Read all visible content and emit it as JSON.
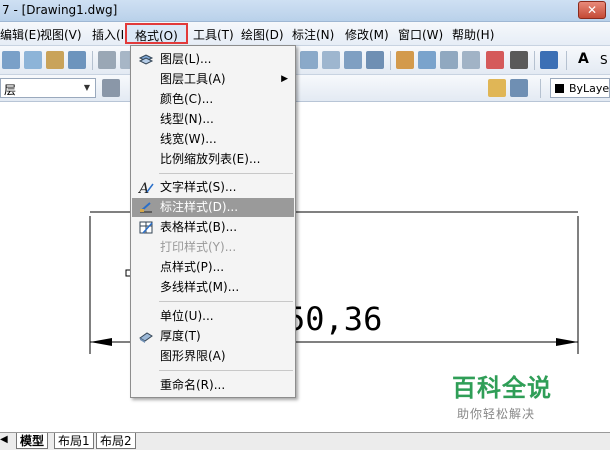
{
  "window": {
    "title": "7 - [Drawing1.dwg]",
    "close_glyph": "✕"
  },
  "menubar": {
    "items": [
      {
        "label": "编辑(E)"
      },
      {
        "label": "视图(V)"
      },
      {
        "label": "插入(I)"
      },
      {
        "label": "格式(O)"
      },
      {
        "label": "工具(T)"
      },
      {
        "label": "绘图(D)"
      },
      {
        "label": "标注(N)"
      },
      {
        "label": "修改(M)"
      },
      {
        "label": "窗口(W)"
      },
      {
        "label": "帮助(H)"
      }
    ]
  },
  "toolbar": {
    "layer_combo_value": "层",
    "style_label": "S",
    "bylayer_label": "ByLayer"
  },
  "format_menu": {
    "items": [
      {
        "label": "图层(L)...",
        "icon": "layers-icon"
      },
      {
        "label": "图层工具(A)",
        "submenu": true
      },
      {
        "label": "颜色(C)..."
      },
      {
        "label": "线型(N)..."
      },
      {
        "label": "线宽(W)..."
      },
      {
        "label": "比例缩放列表(E)..."
      },
      {
        "label": "文字样式(S)...",
        "icon": "text-style-icon"
      },
      {
        "label": "标注样式(D)...",
        "icon": "dimension-style-icon",
        "highlighted": true
      },
      {
        "label": "表格样式(B)...",
        "icon": "table-style-icon"
      },
      {
        "label": "打印样式(Y)...",
        "disabled": true
      },
      {
        "label": "点样式(P)..."
      },
      {
        "label": "多线样式(M)..."
      },
      {
        "label": "单位(U)..."
      },
      {
        "label": "厚度(T)",
        "icon": "thickness-icon"
      },
      {
        "label": "图形界限(A)"
      },
      {
        "label": "重命名(R)..."
      }
    ]
  },
  "drawing": {
    "dimension_text": "50,36"
  },
  "layout_tabs": {
    "tabs": [
      "模型",
      "布局1",
      "布局2"
    ]
  },
  "watermark": {
    "title": "百科全说",
    "subtitle": "助你轻松解决"
  },
  "colors": {
    "menu_highlight_border": "#e23a3a",
    "arrow_red": "#e8383d",
    "watermark_green": "#2f9e57",
    "item_highlight": "#9a9a9a"
  }
}
